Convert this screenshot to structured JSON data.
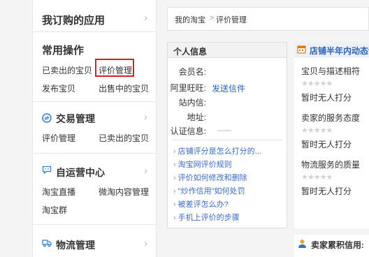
{
  "sidebar": {
    "purchased_apps_title": "我订购的应用",
    "common": {
      "title": "常用操作",
      "links": [
        "已卖出的宝贝",
        "评价管理",
        "发布宝贝",
        "出售中的宝贝"
      ]
    },
    "trade": {
      "title": "交易管理",
      "links": [
        "评价管理",
        "已卖出的宝贝"
      ]
    },
    "self_media": {
      "title": "自运营中心",
      "links": [
        "淘宝直播",
        "微淘内容管理",
        "淘宝群"
      ]
    },
    "logistics": {
      "title": "物流管理"
    },
    "chevron": "›"
  },
  "breadcrumb": {
    "items": [
      "我的淘宝",
      "评价管理"
    ],
    "separator": ">"
  },
  "personal": {
    "title": "个人信息",
    "member_label": "会员名:",
    "wangwang_label": "阿里旺旺:",
    "send_msg": "发送信件",
    "inbox_label": "站内信:",
    "address_label": "地址:",
    "cert_label": "认证信息:"
  },
  "faq": [
    "店铺评分是怎么打分的...",
    "淘宝网评价规则",
    "评价如何修改和删除",
    "\"炒作信用\"如何处罚",
    "被差评怎么办?",
    "手机上评价的步骤"
  ],
  "rating": {
    "title": "店铺半年内动态评",
    "items": [
      {
        "label": "宝贝与描述相符",
        "stars": "★★★★★",
        "status": "暂时无人打分"
      },
      {
        "label": "卖家的服务态度",
        "stars": "★★★★★",
        "status": "暂时无人打分"
      },
      {
        "label": "物流服务的质量",
        "stars": "★★★★★",
        "status": "暂时无人打分"
      }
    ]
  },
  "seller_credit": {
    "label": "卖家累积信用:"
  },
  "colors": {
    "highlight": "#d71f1f",
    "link": "#2c62b8"
  },
  "icons": {
    "trade": "exchange-icon",
    "self_media": "chat-icon",
    "logistics": "truck-icon",
    "rating": "calendar-icon",
    "seller": "user-icon"
  }
}
